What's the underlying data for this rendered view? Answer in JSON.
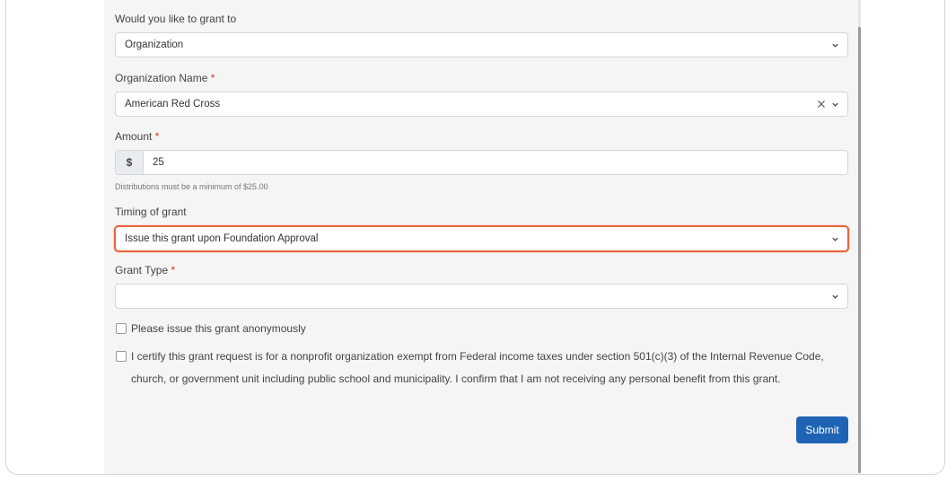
{
  "grant_to": {
    "label": "Would you like to grant to",
    "value": "Organization"
  },
  "organization_name": {
    "label": "Organization Name",
    "required_marker": "*",
    "value": "American Red Cross"
  },
  "amount": {
    "label": "Amount",
    "required_marker": "*",
    "currency_symbol": "$",
    "value": "25",
    "help_text": "Distributions must be a minimum of $25.00"
  },
  "timing": {
    "label": "Timing of grant",
    "value": "Issue this grant upon Foundation Approval",
    "highlight_color": "#e8643a"
  },
  "grant_type": {
    "label": "Grant Type",
    "required_marker": "*",
    "value": ""
  },
  "anonymous": {
    "label": "Please issue this grant anonymously",
    "checked": false
  },
  "certify": {
    "label": "I certify this grant request is for a nonprofit organization exempt from Federal income taxes under section 501(c)(3) of the Internal Revenue Code, church, or government unit including public school and municipality. I confirm that I am not receiving any personal benefit from this grant.",
    "checked": false
  },
  "submit_button": {
    "label": "Submit",
    "color": "#1f63b5"
  },
  "icons": {
    "select": "chevron-down-icon",
    "clear": "close-icon"
  }
}
